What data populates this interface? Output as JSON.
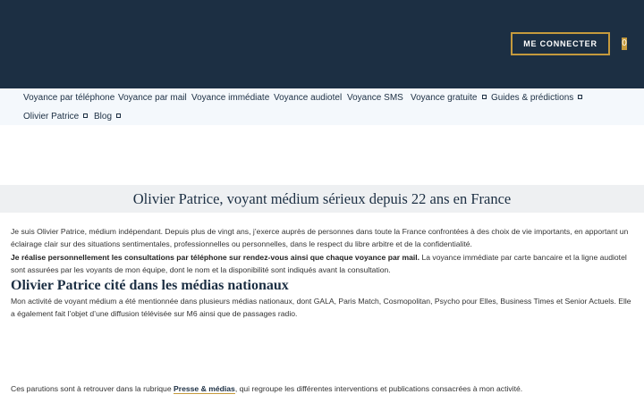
{
  "header": {
    "login_label": "ME CONNECTER",
    "cart_count": "0",
    "accent_color": "#c59a3d",
    "header_color": "#1c2f43"
  },
  "nav": {
    "items": [
      {
        "label": "Voyance par téléphone"
      },
      {
        "label": "Voyance par mail"
      },
      {
        "label": "Voyance immédiate"
      },
      {
        "label": "Voyance audiotel"
      },
      {
        "label": "Voyance SMS"
      },
      {
        "label": "Voyance gratuite"
      },
      {
        "label": "Guides & prédictions"
      },
      {
        "label": "Olivier Patrice"
      },
      {
        "label": "Blog"
      }
    ]
  },
  "main": {
    "title": "Olivier Patrice, voyant médium sérieux depuis 22 ans en France",
    "intro": "Je suis Olivier Patrice, médium indépendant. Depuis plus de vingt ans, j’exerce auprès de personnes dans toute la France confrontées à des choix de vie importants, en apportant un éclairage clair sur des situations sentimentales, professionnelles ou personnelles, dans le respect du libre arbitre et de la confidentialité.",
    "intro_bold": "Je réalise personnellement les consultations par téléphone sur rendez-vous ainsi que chaque voyance par mail.",
    "intro_rest": " La voyance immédiate par carte bancaire et la ligne audiotel sont assurées par les voyants de mon équipe, dont le nom et la disponibilité sont indiqués avant la consultation.",
    "media_title": "Olivier Patrice cité dans les médias nationaux",
    "media_text": "Mon activité de voyant médium a été mentionnée dans plusieurs médias nationaux, dont GALA, Paris Match, Cosmopolitan, Psycho pour Elles, Business Times et Senior Actuels. Elle a également fait l’objet d’une diffusion télévisée sur M6 ainsi que de passages radio.",
    "press_before": "Ces parutions sont à retrouver dans la rubrique ",
    "press_link": "Presse & médias",
    "press_after": ", qui regroupe les différentes interventions et publications consacrées à mon activité."
  }
}
